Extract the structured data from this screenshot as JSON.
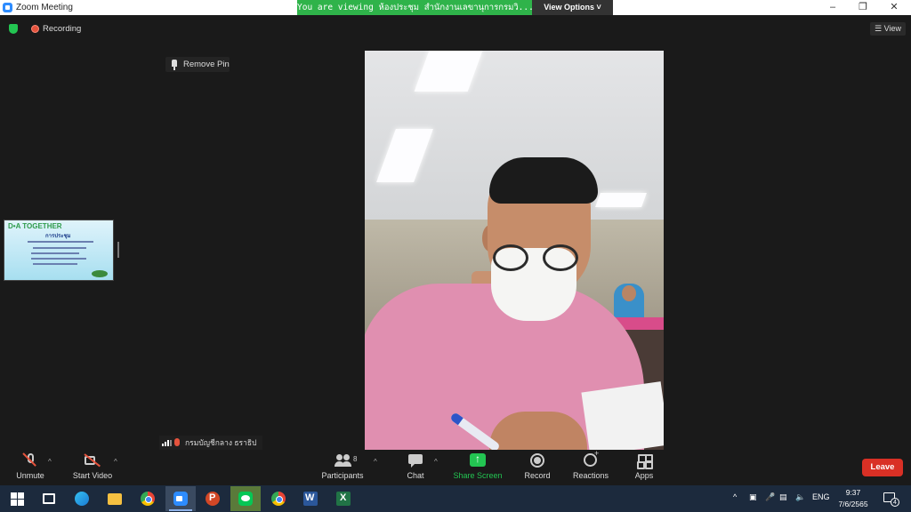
{
  "window": {
    "title": "Zoom Meeting",
    "minimize": "–",
    "restore": "❐",
    "close": "✕"
  },
  "banner": {
    "viewing_text": "You are viewing ห้องประชุม สำนักงานเลขานุการกรมวิ...'s screen",
    "view_options": "View Options ˅"
  },
  "status": {
    "recording_label": "Recording",
    "view_label": "☰ View"
  },
  "pin": {
    "remove_pin_label": "Remove Pin"
  },
  "thumbnail": {
    "logo_text": "D•A TOGETHER",
    "heading": "การประชุม"
  },
  "participant": {
    "name": "กรมบัญชีกลาง ธราธิป"
  },
  "toolbar": {
    "unmute": "Unmute",
    "start_video": "Start Video",
    "participants": "Participants",
    "participants_count": "8",
    "chat": "Chat",
    "share_screen": "Share Screen",
    "record": "Record",
    "reactions": "Reactions",
    "apps": "Apps",
    "leave": "Leave",
    "caret": "^"
  },
  "taskbar": {
    "tray_chevron": "^",
    "language": "ENG",
    "time": "9:37",
    "date": "7/6/2565",
    "notification_count": "4"
  },
  "colors": {
    "share_green": "#23c552",
    "leave_red": "#d93025",
    "banner_green": "#2fb34a",
    "taskbar": "#1c2a3d"
  }
}
